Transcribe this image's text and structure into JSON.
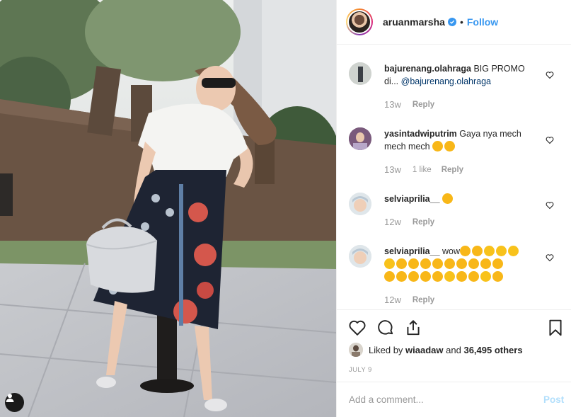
{
  "post": {
    "author": "aruanmarsha",
    "separator": "•",
    "follow_label": "Follow"
  },
  "comments": [
    {
      "user": "bajurenang.olahraga",
      "text": "BIG PROMO di...",
      "mention": "@bajurenang.olahraga",
      "time": "13w",
      "likes": "",
      "reply": "Reply"
    },
    {
      "user": "yasintadwiputrim",
      "text": "Gaya nya mech mech mech",
      "time": "13w",
      "likes": "1 like",
      "reply": "Reply"
    },
    {
      "user": "selviaprilia__",
      "text": "",
      "time": "12w",
      "likes": "",
      "reply": "Reply"
    },
    {
      "user": "selviaprilia__",
      "text": "wow",
      "time": "12w",
      "likes": "",
      "reply": "Reply"
    }
  ],
  "likes": {
    "prefix": "Liked by",
    "user": "wiaadaw",
    "middle": "and",
    "count": "36,495 others"
  },
  "date": "JULY 9",
  "composer": {
    "placeholder": "Add a comment...",
    "post_label": "Post"
  },
  "icons": [
    "verified-badge-icon",
    "heart-icon",
    "comment-icon",
    "share-icon",
    "bookmark-icon",
    "user-tag-icon"
  ],
  "colors": {
    "accent": "#3897f0",
    "muted": "#999999",
    "border": "#efefef",
    "post_disabled": "#b2dffc"
  }
}
